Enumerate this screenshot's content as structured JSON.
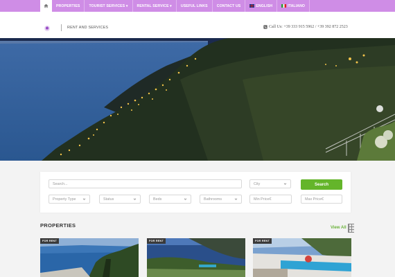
{
  "nav": {
    "home_icon": "home-icon",
    "items": [
      {
        "label": "PROPERTIES"
      },
      {
        "label": "TOURIST SERVICES ▾"
      },
      {
        "label": "RENTAL SERVICE ▾"
      },
      {
        "label": "USEFUL LINKS"
      },
      {
        "label": "CONTACT US"
      },
      {
        "label": "ENGLISH"
      },
      {
        "label": "ITALIANO"
      }
    ],
    "color": "#cf8de6"
  },
  "header": {
    "tagline": "RENT AND SERVICES",
    "phone": "Call Us: +39 333 915 5962 / +39 392 872 2523"
  },
  "hero": {
    "slides": 6,
    "active_slide": 2
  },
  "search": {
    "placeholder": "Search...",
    "city": "City",
    "property_type": "Property Type",
    "status": "Status",
    "beds": "Beds",
    "bathrooms": "Bathrooms",
    "min_price": "Min Price€",
    "max_price": "Max Price€",
    "button": "Search",
    "button_color": "#64b52a"
  },
  "properties": {
    "title": "PROPERTIES",
    "view_all": "View All",
    "cards": [
      {
        "badge": "FOR RENT"
      },
      {
        "badge": "FOR RENT"
      },
      {
        "badge": "FOR RENT"
      }
    ]
  }
}
